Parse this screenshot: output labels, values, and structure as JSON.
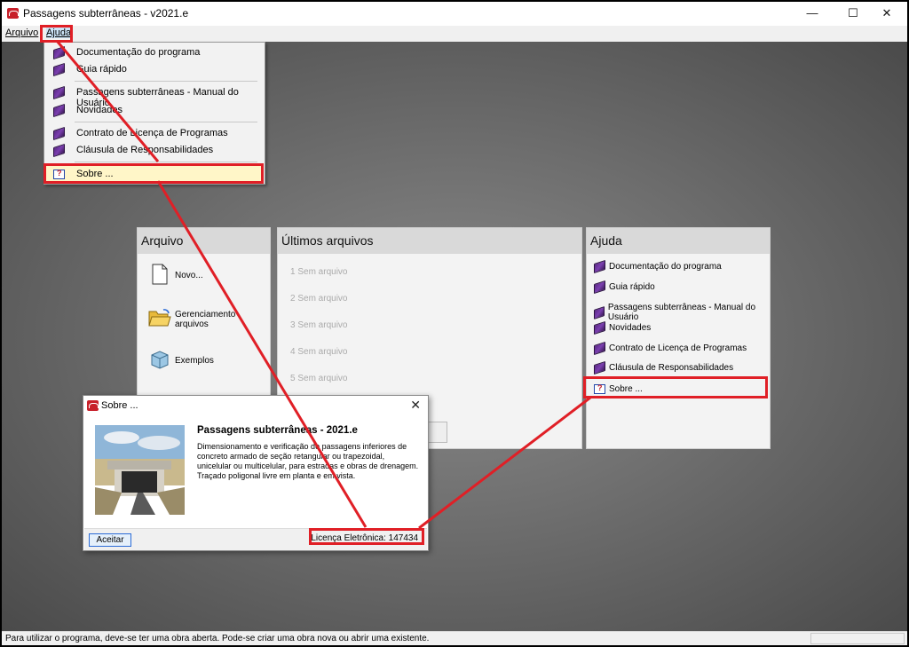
{
  "window": {
    "title": "Passagens subterrâneas - v2021.e",
    "minimize": "—",
    "maximize": "☐",
    "close": "✕"
  },
  "menubar": {
    "items": [
      "Arquivo",
      "Ajuda"
    ]
  },
  "dropdown": {
    "items": [
      "Documentação do programa",
      "Guia rápido",
      "Passagens subterrâneas - Manual do Usuário",
      "Novidades",
      "Contrato de Licença de Programas",
      "Cláusula de Responsabilidades",
      "Sobre ..."
    ]
  },
  "panels": {
    "arquivo": {
      "title": "Arquivo",
      "items": [
        "Novo...",
        "Gerenciamento arquivos",
        "Exemplos"
      ]
    },
    "recent": {
      "title": "Últimos arquivos",
      "items": [
        "1 Sem arquivo",
        "2 Sem arquivo",
        "3 Sem arquivo",
        "4 Sem arquivo",
        "5 Sem arquivo"
      ]
    },
    "ajuda": {
      "title": "Ajuda",
      "items": [
        "Documentação do programa",
        "Guia rápido",
        "Passagens subterrâneas - Manual do Usuário",
        "Novidades",
        "Contrato de Licença de Programas",
        "Cláusula de Responsabilidades",
        "Sobre ..."
      ]
    }
  },
  "dialog": {
    "title": "Sobre ...",
    "close": "✕",
    "heading": "Passagens subterrâneas - 2021.e",
    "description": "Dimensionamento e verificação de passagens inferiores de concreto armado de seção retangular ou trapezoidal, unicelular ou multicelular, para estradas e obras de drenagem. Traçado poligonal livre em planta e em vista.",
    "accept": "Aceitar",
    "license": "Licença Eletrônica: 147434"
  },
  "statusbar": {
    "text": "Para utilizar o programa, deve-se ter uma obra aberta. Pode-se criar uma obra nova ou abrir uma existente."
  },
  "colors": {
    "highlight": "#e01f26",
    "accent": "#2b6bd6"
  },
  "icons": [
    "app-icon",
    "help-book-icon",
    "about-icon",
    "new-file-icon",
    "open-folder-icon",
    "examples-box-icon",
    "close-icon"
  ]
}
